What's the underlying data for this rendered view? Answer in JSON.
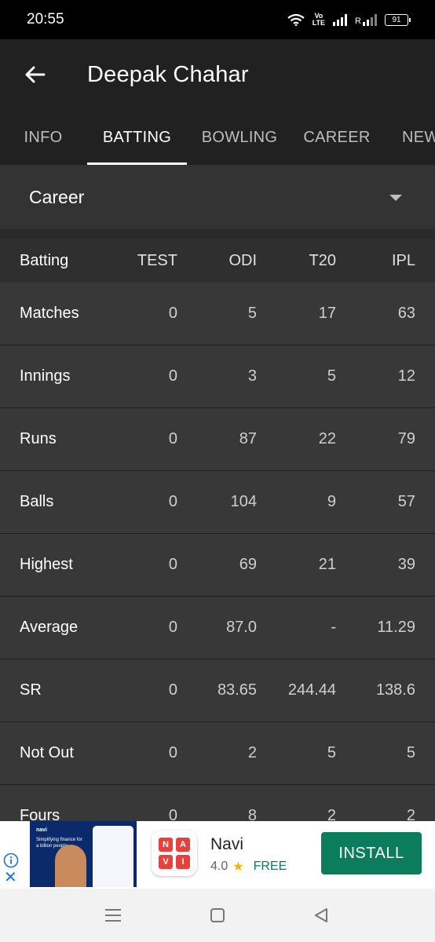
{
  "status_bar": {
    "time": "20:55",
    "volte": "Vo\nLTE",
    "signal_label": "R",
    "battery": "91"
  },
  "header": {
    "title": "Deepak Chahar"
  },
  "tabs": [
    {
      "label": "INFO",
      "active": false
    },
    {
      "label": "BATTING",
      "active": true
    },
    {
      "label": "BOWLING",
      "active": false
    },
    {
      "label": "CAREER",
      "active": false
    },
    {
      "label": "NEWS",
      "active": false
    }
  ],
  "filter": {
    "selected": "Career"
  },
  "table": {
    "columns": [
      "Batting",
      "TEST",
      "ODI",
      "T20",
      "IPL"
    ],
    "rows": [
      {
        "label": "Matches",
        "values": [
          "0",
          "5",
          "17",
          "63"
        ]
      },
      {
        "label": "Innings",
        "values": [
          "0",
          "3",
          "5",
          "12"
        ]
      },
      {
        "label": "Runs",
        "values": [
          "0",
          "87",
          "22",
          "79"
        ]
      },
      {
        "label": "Balls",
        "values": [
          "0",
          "104",
          "9",
          "57"
        ]
      },
      {
        "label": "Highest",
        "values": [
          "0",
          "69",
          "21",
          "39"
        ]
      },
      {
        "label": "Average",
        "values": [
          "0",
          "87.0",
          "-",
          "11.29"
        ]
      },
      {
        "label": "SR",
        "values": [
          "0",
          "83.65",
          "244.44",
          "138.6"
        ]
      },
      {
        "label": "Not Out",
        "values": [
          "0",
          "2",
          "5",
          "5"
        ]
      },
      {
        "label": "Fours",
        "values": [
          "0",
          "8",
          "2",
          "2"
        ]
      }
    ]
  },
  "ad": {
    "image_brand": "navi",
    "image_headline": "Simplifying finance for a billion people.",
    "app_name": "Navi",
    "rating": "4.0",
    "price": "FREE",
    "install_label": "INSTALL",
    "logo_letters": [
      "N",
      "A",
      "V",
      "I"
    ]
  },
  "colors": {
    "background": "#2b2b2b",
    "app_bar": "#212121",
    "row": "#383838",
    "install": "#0b7d5c"
  }
}
